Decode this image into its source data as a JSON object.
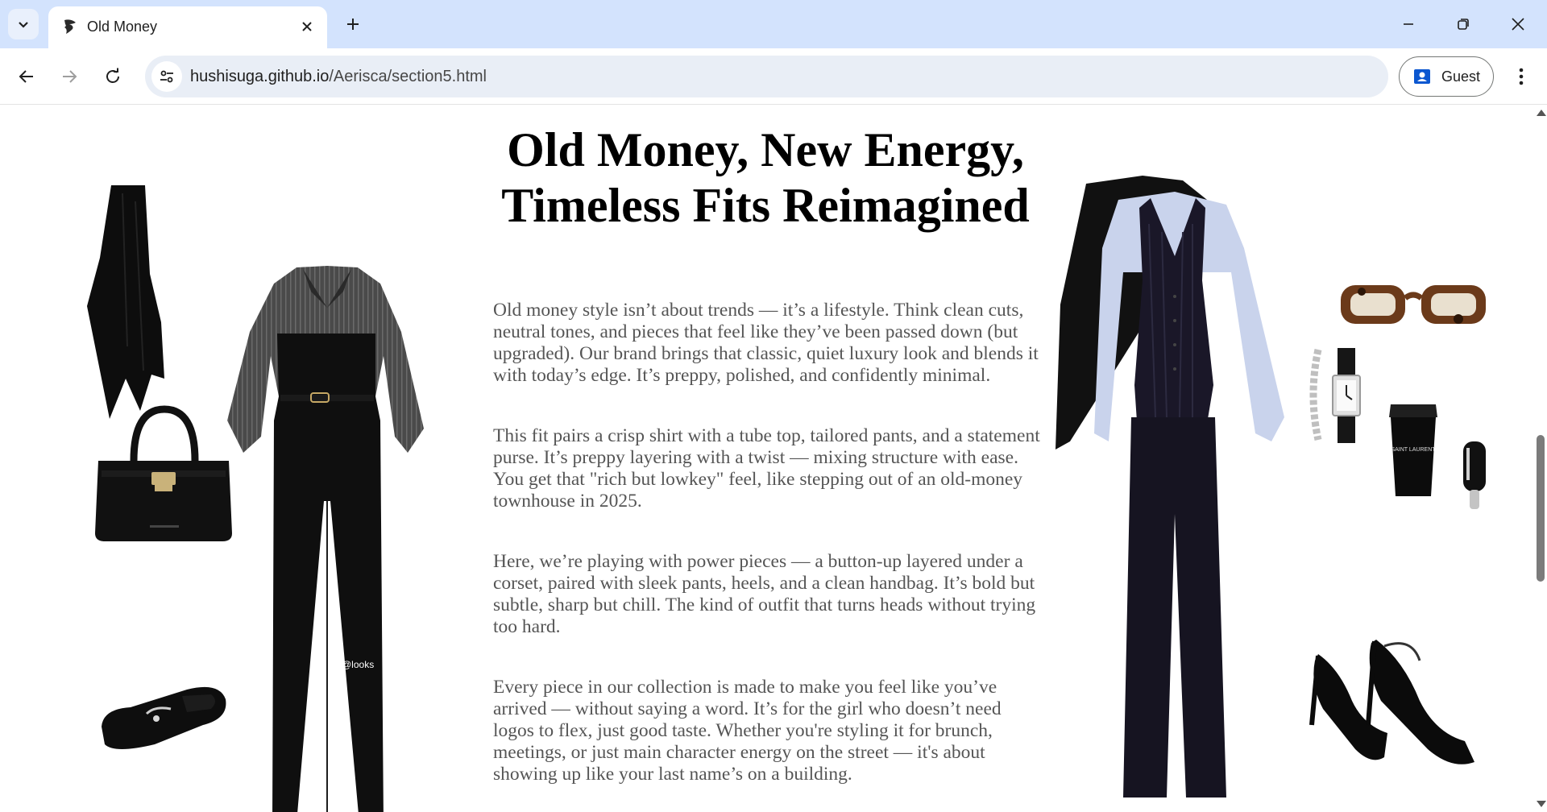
{
  "browser": {
    "tab_title": "Old Money",
    "url_host": "hushisuga.github.io",
    "url_path": "/Aerisca/section5.html",
    "profile_label": "Guest"
  },
  "page": {
    "headline_line1": "Old Money, New Energy,",
    "headline_line2": "Timeless Fits Reimagined",
    "paragraphs": [
      "Old money style isn’t about trends — it’s a lifestyle. Think clean cuts, neutral tones, and pieces that feel like they’ve been passed down (but upgraded). Our brand brings that classic, quiet luxury look and blends it with today’s edge. It’s preppy, polished, and confidently minimal.",
      "This fit pairs a crisp shirt with a tube top, tailored pants, and a statement purse. It’s preppy layering with a twist — mixing structure with ease. You get that \"rich but lowkey\" feel, like stepping out of an old-money townhouse in 2025.",
      "Here, we’re playing with power pieces — a button-up layered under a corset, paired with sleek pants, heels, and a clean handbag. It’s bold but subtle, sharp but chill. The kind of outfit that turns heads without trying too hard.",
      "Every piece in our collection is made to make you feel like you’ve arrived — without saying a word. It’s for the girl who doesn’t need logos to flex, just good taste. Whether you're styling it for brunch, meetings, or just main character energy on the street — it's about showing up like your last name’s on a building."
    ],
    "watermark": "@looks",
    "cup_text": "SAINT LAURENT"
  },
  "colors": {
    "tabbar": "#d3e3fd",
    "omnibox": "#e9eef6",
    "body_text": "#555555",
    "headline": "#000000"
  }
}
